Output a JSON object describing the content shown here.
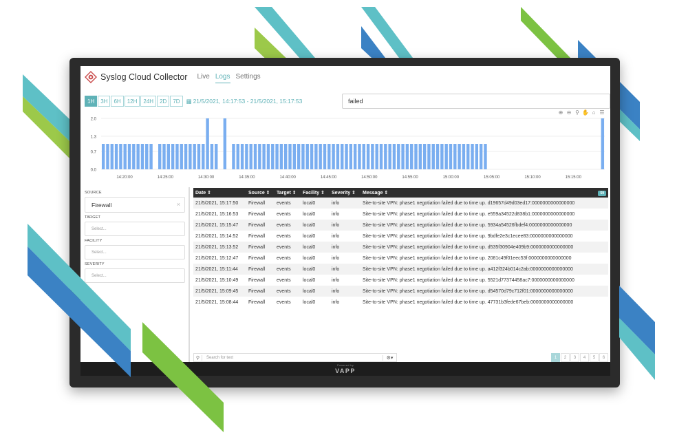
{
  "app": {
    "title": "Syslog Cloud Collector",
    "nav": [
      {
        "label": "Live",
        "active": false
      },
      {
        "label": "Logs",
        "active": true
      },
      {
        "label": "Settings",
        "active": false
      }
    ]
  },
  "time_range": {
    "buttons": [
      "1H",
      "3H",
      "6H",
      "12H",
      "24H",
      "2D",
      "7D"
    ],
    "active": "1H",
    "range_text": "21/5/2021, 14:17:53 - 21/5/2021, 15:17:53"
  },
  "search": {
    "value": "failed"
  },
  "chart_tools": [
    "⊕",
    "⊖",
    "⚲",
    "✋",
    "⌂",
    "☰"
  ],
  "chart_data": {
    "type": "bar",
    "y_ticks": [
      "2.0",
      "1.3",
      "0.7",
      "0.0"
    ],
    "ylim": [
      0,
      2
    ],
    "x_ticks": [
      "14:20:00",
      "14:25:00",
      "14:30:00",
      "14:35:00",
      "14:40:00",
      "14:45:00",
      "14:50:00",
      "14:55:00",
      "15:00:00",
      "15:05:00",
      "15:10:00",
      "15:15:00"
    ],
    "values": [
      1,
      1,
      1,
      1,
      1,
      1,
      1,
      1,
      1,
      1,
      1,
      1,
      0,
      1,
      1,
      1,
      1,
      1,
      1,
      1,
      1,
      1,
      1,
      1,
      2,
      1,
      1,
      0,
      2,
      0,
      1,
      1,
      1,
      1,
      1,
      1,
      1,
      1,
      1,
      1,
      1,
      1,
      1,
      1,
      1,
      1,
      1,
      1,
      1,
      1,
      1,
      1,
      1,
      1,
      1,
      1,
      1,
      1,
      1,
      1,
      1,
      1,
      1,
      1,
      1,
      1,
      1,
      1,
      1,
      1,
      1,
      1,
      1,
      1,
      1,
      1,
      1,
      1,
      1,
      1,
      1,
      1,
      1,
      1,
      1,
      1,
      1,
      1,
      1,
      0,
      0,
      0,
      0,
      0,
      0,
      0,
      0,
      0,
      0,
      0,
      0,
      0,
      0,
      0,
      0,
      0,
      0,
      0,
      0,
      0,
      0,
      0,
      0,
      0,
      0,
      2
    ]
  },
  "filters": [
    {
      "label": "SOURCE",
      "value": "Firewall",
      "placeholder": ""
    },
    {
      "label": "TARGET",
      "value": "",
      "placeholder": "Select..."
    },
    {
      "label": "FACILITY",
      "value": "",
      "placeholder": "Select..."
    },
    {
      "label": "SEVERITY",
      "value": "",
      "placeholder": "Select..."
    }
  ],
  "table": {
    "columns": [
      "Date ⇕",
      "Source ⇕",
      "Target ⇕",
      "Facility ⇕",
      "Severity ⇕",
      "Message ⇕"
    ],
    "count": "59",
    "rows": [
      [
        "21/5/2021, 15:17:50",
        "Firewall",
        "events",
        "local0",
        "info",
        "Site-to-site VPN: phase1 negotiation failed due to time up. d19657d49d03ed17:0000000000000000"
      ],
      [
        "21/5/2021, 15:16:53",
        "Firewall",
        "events",
        "local0",
        "info",
        "Site-to-site VPN: phase1 negotiation failed due to time up. e559a34522d838b1:0000000000000000"
      ],
      [
        "21/5/2021, 15:15:47",
        "Firewall",
        "events",
        "local0",
        "info",
        "Site-to-site VPN: phase1 negotiation failed due to time up. 5934a54526fbdef4:0000000000000000"
      ],
      [
        "21/5/2021, 15:14:52",
        "Firewall",
        "events",
        "local0",
        "info",
        "Site-to-site VPN: phase1 negotiation failed due to time up. 9bdfe2e3c1ecee83:0000000000000000"
      ],
      [
        "21/5/2021, 15:13:52",
        "Firewall",
        "events",
        "local0",
        "info",
        "Site-to-site VPN: phase1 negotiation failed due to time up. d535f30904e409b9:0000000000000000"
      ],
      [
        "21/5/2021, 15:12:47",
        "Firewall",
        "events",
        "local0",
        "info",
        "Site-to-site VPN: phase1 negotiation failed due to time up. 2081c49f01eec53f:0000000000000000"
      ],
      [
        "21/5/2021, 15:11:44",
        "Firewall",
        "events",
        "local0",
        "info",
        "Site-to-site VPN: phase1 negotiation failed due to time up. a412f324b014c2ab:0000000000000000"
      ],
      [
        "21/5/2021, 15:10:49",
        "Firewall",
        "events",
        "local0",
        "info",
        "Site-to-site VPN: phase1 negotiation failed due to time up. 5521d77374458ac7:0000000000000000"
      ],
      [
        "21/5/2021, 15:09:45",
        "Firewall",
        "events",
        "local0",
        "info",
        "Site-to-site VPN: phase1 negotiation failed due to time up. d54570d79c712f01:0000000000000000"
      ],
      [
        "21/5/2021, 15:08:44",
        "Firewall",
        "events",
        "local0",
        "info",
        "Site-to-site VPN: phase1 negotiation failed due to time up. 47731b3fede67beb:0000000000000000"
      ]
    ]
  },
  "bottom": {
    "search_placeholder": "Search for text",
    "pages": [
      "1",
      "2",
      "3",
      "4",
      "5",
      "6"
    ],
    "active_page": "1"
  },
  "footer": {
    "powered": "Powered by",
    "brand": "VAPP"
  },
  "colors": {
    "accent": "#5fb2b7",
    "bar": "#7aaef0",
    "teal_ribbon": "#5ec0c6",
    "blue_ribbon": "#3b82c4",
    "green_ribbon": "#8cc63f"
  }
}
